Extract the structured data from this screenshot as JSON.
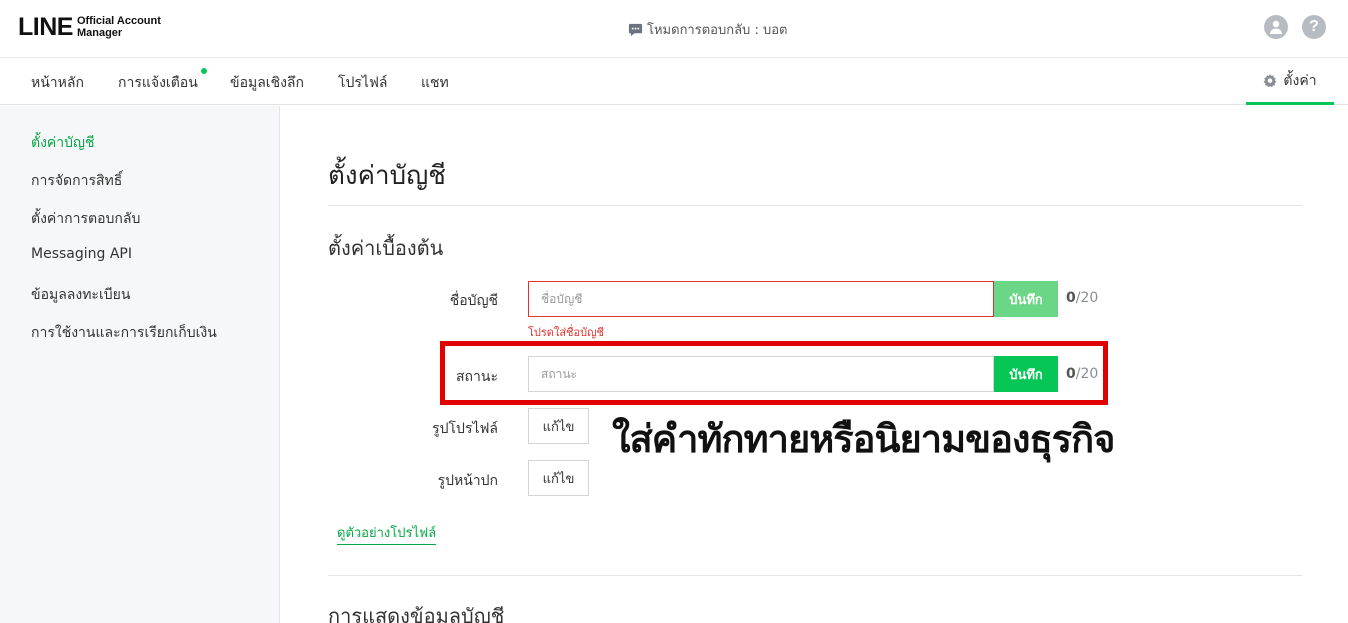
{
  "header": {
    "logo_main": "LINE",
    "logo_sub": "Official Account Manager",
    "mode_text": "โหมดการตอบกลับ : บอต"
  },
  "nav": {
    "items": [
      "หน้าหลัก",
      "การแจ้งเตือน",
      "ข้อมูลเชิงลึก",
      "โปรไฟล์",
      "แชท"
    ],
    "settings": "ตั้งค่า"
  },
  "sidebar": {
    "items": [
      "ตั้งค่าบัญชี",
      "การจัดการสิทธิ์",
      "ตั้งค่าการตอบกลับ",
      "Messaging API",
      "ข้อมูลลงทะเบียน",
      "การใช้งานและการเรียกเก็บเงิน"
    ]
  },
  "main": {
    "page_title": "ตั้งค่าบัญชี",
    "section_basic": "ตั้งค่าเบื้องต้น",
    "account_name": {
      "label": "ชื่อบัญชี",
      "placeholder": "ชื่อบัญชี",
      "save": "บันทึก",
      "count": "0",
      "max": "/20",
      "error": "โปรดใส่ชื่อบัญชี"
    },
    "status": {
      "label": "สถานะ",
      "placeholder": "สถานะ",
      "save": "บันทึก",
      "count": "0",
      "max": "/20"
    },
    "profile_image": {
      "label": "รูปโปรไฟล์",
      "edit": "แก้ไข"
    },
    "cover_image": {
      "label": "รูปหน้าปก",
      "edit": "แก้ไข"
    },
    "preview_link": "ดูตัวอย่างโปรไฟล์",
    "section_display": "การแสดงข้อมูลบัญชี"
  },
  "annotation": {
    "caption": "ใส่คำทักทายหรือนิยามของธุรกิจ",
    "highlight_color": "#e00000"
  },
  "colors": {
    "accent": "#06c755",
    "error": "#e0332f"
  }
}
